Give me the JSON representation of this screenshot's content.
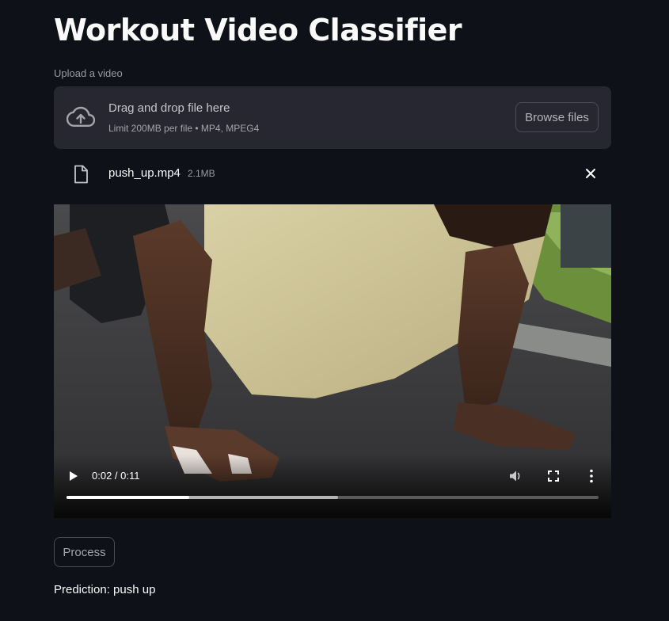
{
  "page": {
    "title": "Workout Video Classifier"
  },
  "uploader": {
    "label": "Upload a video",
    "drop_text": "Drag and drop file here",
    "limit_text": "Limit 200MB per file • MP4, MPEG4",
    "browse_label": "Browse files",
    "icon": "cloud-upload-icon"
  },
  "file": {
    "name": "push_up.mp4",
    "size": "2.1MB",
    "icon": "file-icon",
    "remove_icon": "close-icon"
  },
  "video": {
    "time": "0:02 / 0:11",
    "played_fraction": 0.23,
    "buffered_fraction": 0.51,
    "controls": [
      "play-icon",
      "volume-icon",
      "fullscreen-icon",
      "more-options-icon"
    ]
  },
  "actions": {
    "process_label": "Process"
  },
  "result": {
    "prediction_text": "Prediction: push up"
  },
  "colors": {
    "background": "#0e1117",
    "panel": "#262730",
    "text": "#fafafa",
    "muted": "#9a9ba2",
    "border": "#4a4c55"
  }
}
